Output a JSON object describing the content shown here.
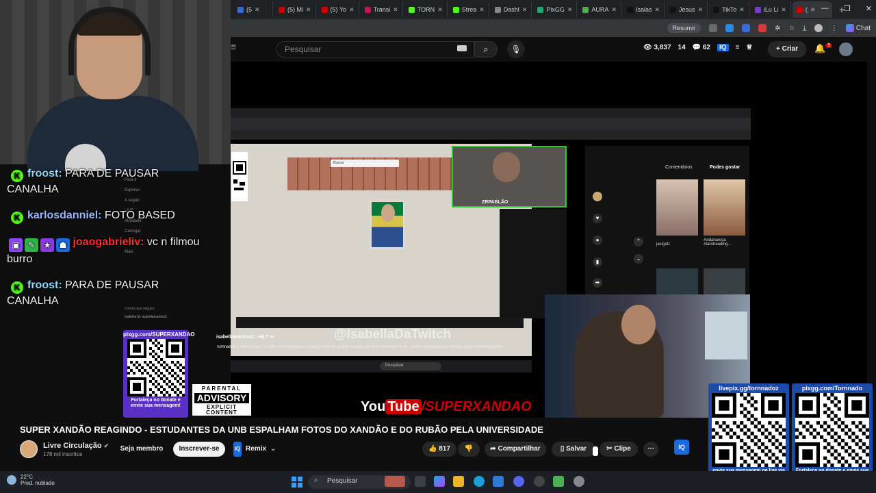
{
  "browser": {
    "tabs": [
      {
        "label": "(5",
        "color": "#3a6ad8"
      },
      {
        "label": "(5) Mi",
        "color": "#cc0000"
      },
      {
        "label": "(5) Yo",
        "color": "#cc0000"
      },
      {
        "label": "Transi",
        "color": "#c2185b"
      },
      {
        "label": "TORN",
        "color": "#53fc18"
      },
      {
        "label": "Strea",
        "color": "#53fc18"
      },
      {
        "label": "Dashl",
        "color": "#888888"
      },
      {
        "label": "PixGG",
        "color": "#1ea86a"
      },
      {
        "label": "AURA",
        "color": "#4caf50"
      },
      {
        "label": "Isalas",
        "color": "#111111"
      },
      {
        "label": "Jesus",
        "color": "#111111"
      },
      {
        "label": "TikTo",
        "color": "#111111"
      },
      {
        "label": "iLu Li",
        "color": "#7a3ac8"
      },
      {
        "label": "(",
        "color": "#cc0000"
      }
    ],
    "resume_label": "Resumir",
    "chat_label": "Chat"
  },
  "youtube": {
    "search_placeholder": "Pesquisar",
    "stats": {
      "views": "3,837",
      "a": "14",
      "b": "62"
    },
    "create_label": "Criar",
    "bell_badge": "5",
    "video_title": "SUPER XANDÃO REAGINDO - ESTUDANTES DA UNB ESPALHAM FOTOS DO XANDÃO E DO RUBÃO PELA UNIVERSIDADE",
    "channel_name": "Livre Circulação",
    "channel_subs": "178 mil inscritos",
    "member_label": "Seja membro",
    "subscribe_label": "Inscrever-se",
    "remix_label": "Remix",
    "like_count": "817",
    "share_label": "Compartilhar",
    "save_label": "Salvar",
    "clip_label": "Clipe",
    "iq_label": "IQ"
  },
  "chat": [
    {
      "user": "froost",
      "text": " PARA DE PAUSAR CANALHA",
      "platform": "kick"
    },
    {
      "user": "karlosdanniel",
      "text": " FOTO BASED",
      "platform": "kick"
    },
    {
      "user": "joaogabrieliv",
      "text": " vc n filmou burro",
      "platform": "twitch"
    },
    {
      "user": "froost",
      "text": " PARA DE PAUSAR CANALHA",
      "platform": "kick"
    }
  ],
  "behind_sidebar": [
    "Para ti",
    "Explorar",
    "A seguir",
    "LIVE",
    "Atividade",
    "Carregar",
    "Perfil",
    "Mais"
  ],
  "behind_follow_label": "Contas que segues",
  "behind_follow_user": "Isabella M. isabellamartins2",
  "inner": {
    "watermark": "@IsabellaDaTwitch",
    "credit": "isabellamartins2 · Há 7 m",
    "caption": "Tornnadoz e nathan vão na UNB (Universidade) e colam Fotos de Super Xandão, Rubem Gonzales e Or.. envios #supexandao #foryou #fyp #mulherdepreso",
    "cam_label": "ZRPABLÃO",
    "tab_comments": "Comentários",
    "tab_likes": "Podes gostar",
    "thumb1_cap": "jacigal1",
    "thumb2_cap": "#vidanaroça #tarotreading...",
    "tb_search": "Pesquisar",
    "search_box": "Buscar"
  },
  "overlay": {
    "qr_left_head": "pixgg.com/SUPERXANDAO",
    "qr_left_foot": "Fortaleça no donate e envie sua mensagem!",
    "qr_mid_head": "livepix.gg/tornnadoz",
    "qr_mid_foot": "envie sua mensagem na live via pix!",
    "qr_right_head": "pixgg.com/Tornnado",
    "qr_right_foot": "Fortaleça no donate e envie sua mensagem!",
    "parental_1": "PARENTAL",
    "parental_2": "ADVISORY",
    "parental_3": "EXPLICIT CONTENT",
    "brand_you": "You",
    "brand_tube": "Tube",
    "brand_slash": "/SUPERXANDAO"
  },
  "taskbar": {
    "temp": "22°C",
    "weather": "Pred. nublado",
    "search": "Pesquisar"
  }
}
